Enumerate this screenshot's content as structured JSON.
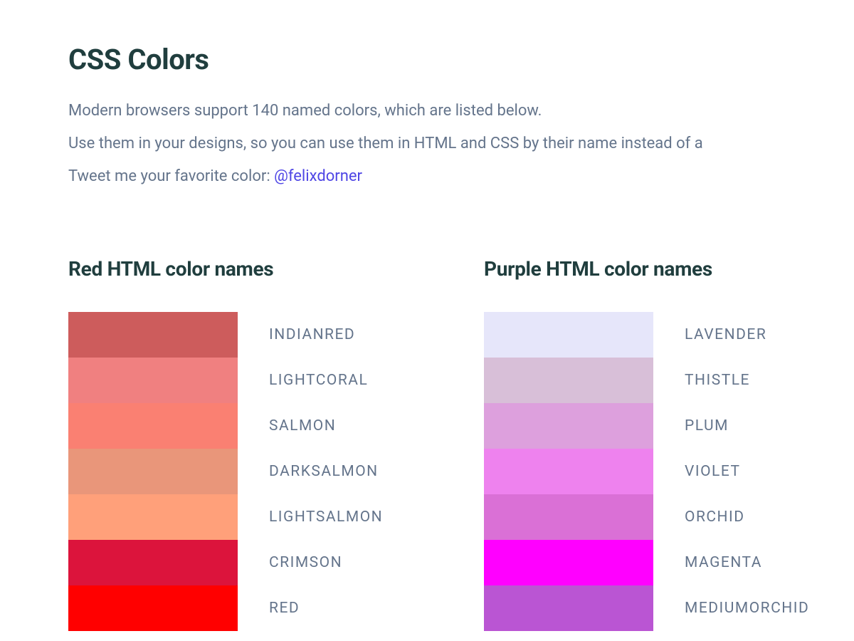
{
  "header": {
    "title": "CSS Colors",
    "intro_line1": "Modern browsers support 140 named colors, which are listed below.",
    "intro_line2": "Use them in your designs, so you can use them in HTML and CSS by their name instead of a",
    "intro_line3_prefix": "Tweet me your favorite color: ",
    "intro_link_text": "@felixdorner"
  },
  "columns": [
    {
      "title": "Red HTML color names",
      "swatches": [
        {
          "label": "INDIANRED",
          "color": "#CD5C5C"
        },
        {
          "label": "LIGHTCORAL",
          "color": "#F08080"
        },
        {
          "label": "SALMON",
          "color": "#FA8072"
        },
        {
          "label": "DARKSALMON",
          "color": "#E9967A"
        },
        {
          "label": "LIGHTSALMON",
          "color": "#FFA07A"
        },
        {
          "label": "CRIMSON",
          "color": "#DC143C"
        },
        {
          "label": "RED",
          "color": "#FF0000"
        }
      ]
    },
    {
      "title": "Purple HTML color names",
      "swatches": [
        {
          "label": "LAVENDER",
          "color": "#E6E6FA"
        },
        {
          "label": "THISTLE",
          "color": "#D8BFD8"
        },
        {
          "label": "PLUM",
          "color": "#DDA0DD"
        },
        {
          "label": "VIOLET",
          "color": "#EE82EE"
        },
        {
          "label": "ORCHID",
          "color": "#DA70D6"
        },
        {
          "label": "MAGENTA",
          "color": "#FF00FF"
        },
        {
          "label": "MEDIUMORCHID",
          "color": "#BA55D3"
        }
      ]
    }
  ]
}
